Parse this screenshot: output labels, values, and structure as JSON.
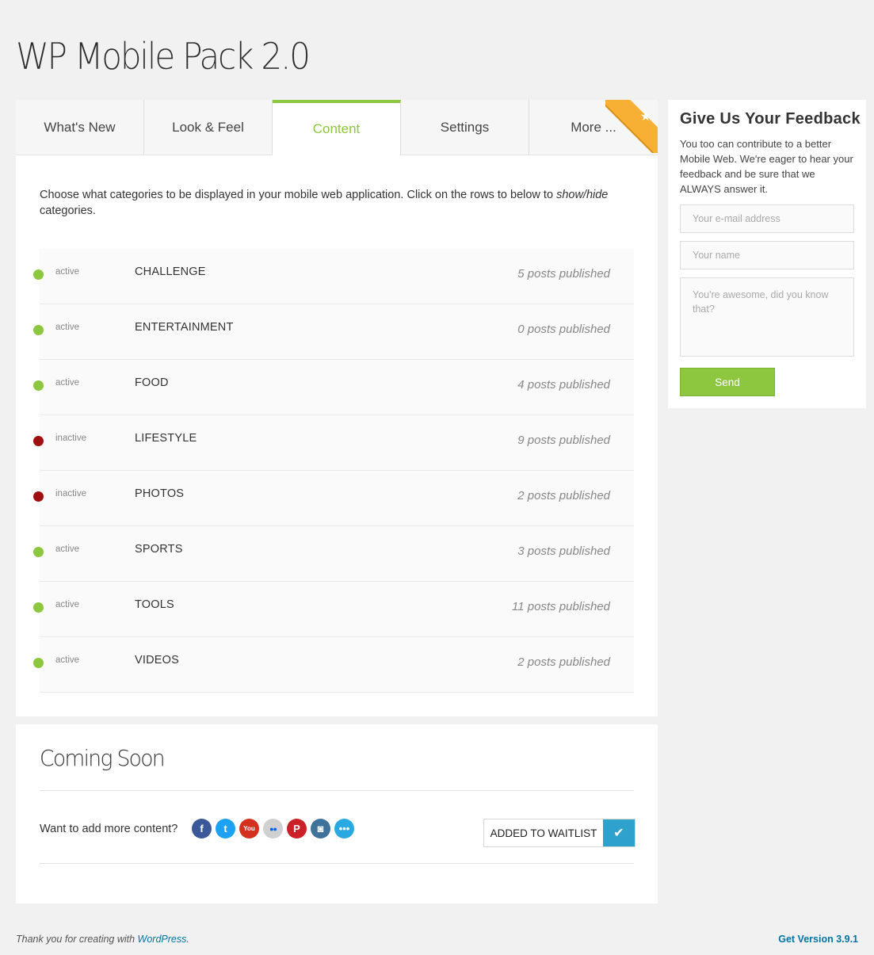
{
  "page": {
    "title": "WP Mobile Pack 2.0"
  },
  "tabs": [
    {
      "label": "What's New"
    },
    {
      "label": "Look & Feel"
    },
    {
      "label": "Content"
    },
    {
      "label": "Settings"
    },
    {
      "label": "More ..."
    }
  ],
  "content": {
    "intro_prefix": "Choose what categories to be displayed in your mobile web application. Click on the rows to below to ",
    "intro_em": "show/hide",
    "intro_suffix": " categories.",
    "categories": [
      {
        "status": "active",
        "name": "CHALLENGE",
        "posts": "5 posts published"
      },
      {
        "status": "active",
        "name": "ENTERTAINMENT",
        "posts": "0 posts published"
      },
      {
        "status": "active",
        "name": "FOOD",
        "posts": "4 posts published"
      },
      {
        "status": "inactive",
        "name": "LIFESTYLE",
        "posts": "9 posts published"
      },
      {
        "status": "inactive",
        "name": "PHOTOS",
        "posts": "2 posts published"
      },
      {
        "status": "active",
        "name": "SPORTS",
        "posts": "3 posts published"
      },
      {
        "status": "active",
        "name": "TOOLS",
        "posts": "11 posts published"
      },
      {
        "status": "active",
        "name": "VIDEOS",
        "posts": "2 posts published"
      }
    ]
  },
  "coming_soon": {
    "title": "Coming Soon",
    "question": "Want to add more content?",
    "socials": [
      {
        "icon": "facebook-icon",
        "glyph": "f",
        "color": "#3b5998"
      },
      {
        "icon": "twitter-icon",
        "glyph": "t",
        "color": "#1da1f2"
      },
      {
        "icon": "youtube-icon",
        "glyph": "You",
        "color": "#d4301f"
      },
      {
        "icon": "flickr-icon",
        "glyph": "●●",
        "color": "#d0d0d0"
      },
      {
        "icon": "pinterest-icon",
        "glyph": "P",
        "color": "#cb2027"
      },
      {
        "icon": "instagram-icon",
        "glyph": "◙",
        "color": "#3f729b"
      },
      {
        "icon": "more-icon",
        "glyph": "•••",
        "color": "#29a9e1"
      }
    ],
    "waitlist_label": "ADDED TO WAITLIST"
  },
  "feedback": {
    "title": "Give Us Your Feedback",
    "text": "You too can contribute to a better Mobile Web. We're eager to hear your feedback and be sure that we ALWAYS answer it.",
    "email_placeholder": "Your e-mail address",
    "name_placeholder": "Your name",
    "message_placeholder": "You're awesome, did you know that?",
    "send_label": "Send"
  },
  "footer": {
    "thanks_prefix": "Thank you for creating with ",
    "wordpress_link": "WordPress",
    "thanks_suffix": ".",
    "version_link": "Get Version 3.9.1"
  },
  "colors": {
    "accent_green": "#8dc63f",
    "inactive_red": "#a00f0f",
    "ribbon_orange": "#f7b033",
    "link_blue": "#0074a2",
    "check_blue": "#2ea2cc"
  }
}
